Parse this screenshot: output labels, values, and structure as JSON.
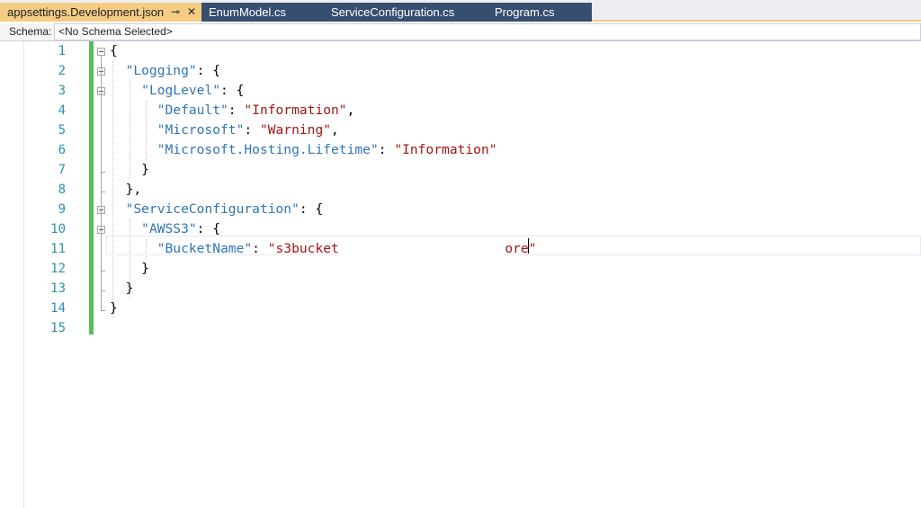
{
  "tabs": [
    {
      "label": "appsettings.Development.json",
      "active": true,
      "pin_icon": "pin-icon",
      "close_icon": "close-icon"
    },
    {
      "label": "EnumModel.cs",
      "active": false
    },
    {
      "label": "ServiceConfiguration.cs",
      "active": false
    },
    {
      "label": "Program.cs",
      "active": false
    }
  ],
  "schema": {
    "label": "Schema:",
    "selected": "<No Schema Selected>"
  },
  "editor": {
    "line_numbers": [
      "1",
      "2",
      "3",
      "4",
      "5",
      "6",
      "7",
      "8",
      "9",
      "10",
      "11",
      "12",
      "13",
      "14",
      "15"
    ],
    "lines": [
      [
        {
          "t": "p",
          "v": "{"
        }
      ],
      [
        {
          "t": "p",
          "v": "  "
        },
        {
          "t": "k",
          "v": "\"Logging\""
        },
        {
          "t": "p",
          "v": ": {"
        }
      ],
      [
        {
          "t": "p",
          "v": "    "
        },
        {
          "t": "k",
          "v": "\"LogLevel\""
        },
        {
          "t": "p",
          "v": ": {"
        }
      ],
      [
        {
          "t": "p",
          "v": "      "
        },
        {
          "t": "k",
          "v": "\"Default\""
        },
        {
          "t": "p",
          "v": ": "
        },
        {
          "t": "s",
          "v": "\"Information\""
        },
        {
          "t": "p",
          "v": ","
        }
      ],
      [
        {
          "t": "p",
          "v": "      "
        },
        {
          "t": "k",
          "v": "\"Microsoft\""
        },
        {
          "t": "p",
          "v": ": "
        },
        {
          "t": "s",
          "v": "\"Warning\""
        },
        {
          "t": "p",
          "v": ","
        }
      ],
      [
        {
          "t": "p",
          "v": "      "
        },
        {
          "t": "k",
          "v": "\"Microsoft.Hosting.Lifetime\""
        },
        {
          "t": "p",
          "v": ": "
        },
        {
          "t": "s",
          "v": "\"Information\""
        }
      ],
      [
        {
          "t": "p",
          "v": "    }"
        }
      ],
      [
        {
          "t": "p",
          "v": "  },"
        }
      ],
      [
        {
          "t": "p",
          "v": "  "
        },
        {
          "t": "k",
          "v": "\"ServiceConfiguration\""
        },
        {
          "t": "p",
          "v": ": {"
        }
      ],
      [
        {
          "t": "p",
          "v": "    "
        },
        {
          "t": "k",
          "v": "\"AWSS3\""
        },
        {
          "t": "p",
          "v": ": {"
        }
      ],
      [
        {
          "t": "p",
          "v": "      "
        },
        {
          "t": "k",
          "v": "\"BucketName\""
        },
        {
          "t": "p",
          "v": ": "
        },
        {
          "t": "s",
          "v": "\"s3bucket"
        },
        {
          "t": "r",
          "v": "                     "
        },
        {
          "t": "s",
          "v": "ore\""
        }
      ],
      [
        {
          "t": "p",
          "v": "    }"
        }
      ],
      [
        {
          "t": "p",
          "v": "  }"
        }
      ],
      [
        {
          "t": "p",
          "v": "}"
        }
      ],
      [
        {
          "t": "p",
          "v": ""
        }
      ]
    ]
  },
  "colors": {
    "active_tab": "#f5cc84",
    "inactive_tab": "#364e6f",
    "key": "#2e75b6",
    "string": "#a31515",
    "line_number": "#2b91af",
    "change_bar": "#57bf57"
  }
}
